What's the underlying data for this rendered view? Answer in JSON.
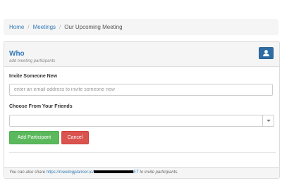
{
  "breadcrumb": {
    "items": [
      "Home",
      "Meetings"
    ],
    "separator": "/",
    "current": "Our Upcoming Meeting"
  },
  "panel": {
    "title": "Who",
    "subtitle": "add meeting participants",
    "user_button_icon": "user-icon"
  },
  "invite": {
    "label": "Invite Someone New",
    "placeholder": "enter an email address to invite someone new",
    "value": ""
  },
  "friends": {
    "label": "Choose From Your Friends",
    "selected": ""
  },
  "buttons": {
    "add": "Add Participant",
    "cancel": "Cancel"
  },
  "footer": {
    "text_before": "You can also share",
    "link_start": "https://meetingplanner.io/",
    "link_end": "ET",
    "text_after": "to invite participants."
  },
  "colors": {
    "link": "#337ab7",
    "primary": "#2e6da4",
    "success": "#5cb85c",
    "danger": "#d9534f"
  }
}
